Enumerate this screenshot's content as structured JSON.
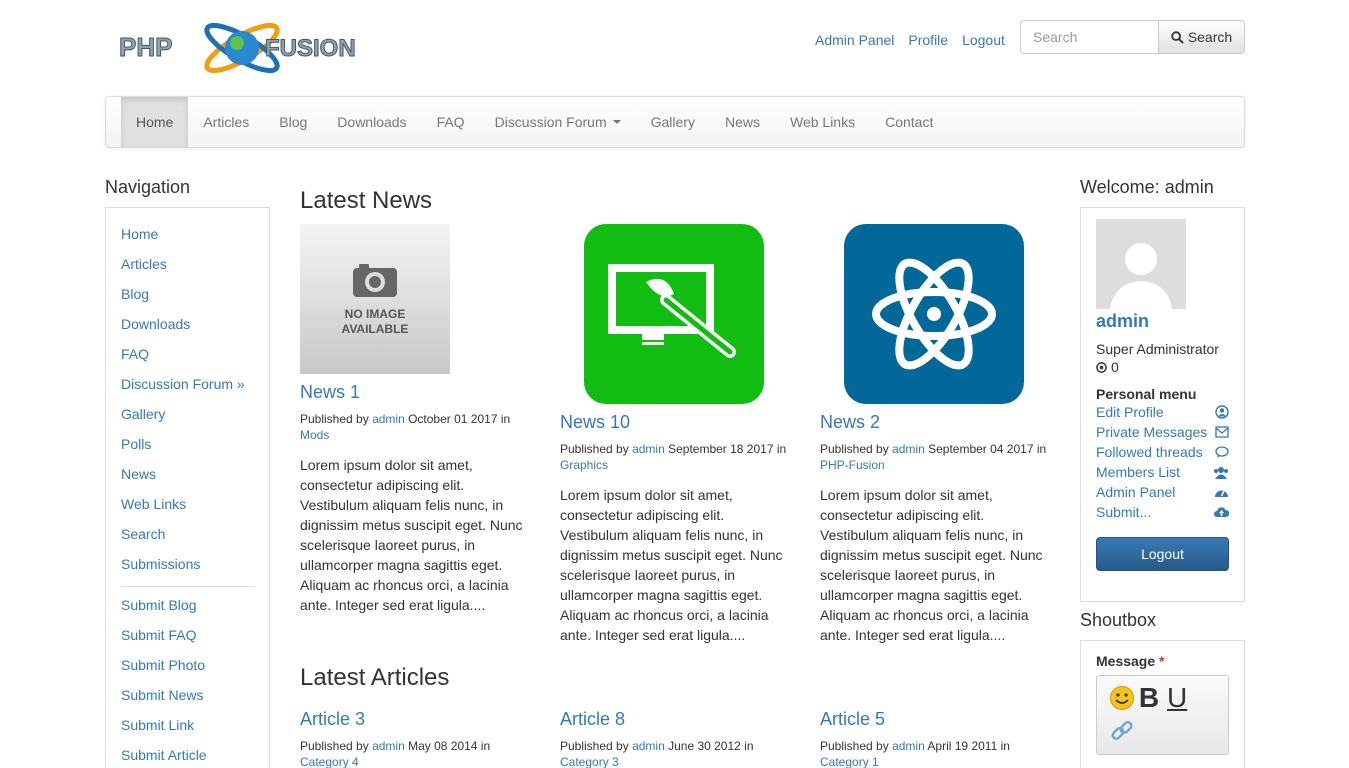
{
  "header": {
    "logo_text": "PHP-FUSION",
    "links": [
      "Admin Panel",
      "Profile",
      "Logout"
    ],
    "search_placeholder": "Search",
    "search_button": "Search"
  },
  "nav": {
    "items": [
      "Home",
      "Articles",
      "Blog",
      "Downloads",
      "FAQ",
      "Discussion Forum",
      "Gallery",
      "News",
      "Web Links",
      "Contact"
    ],
    "active": "Home"
  },
  "left_sidebar": {
    "title": "Navigation",
    "links": [
      "Home",
      "Articles",
      "Blog",
      "Downloads",
      "FAQ",
      "Discussion Forum »",
      "Gallery",
      "Polls",
      "News",
      "Web Links",
      "Search",
      "Submissions"
    ],
    "submit_links": [
      "Submit Blog",
      "Submit FAQ",
      "Submit Photo",
      "Submit News",
      "Submit Link",
      "Submit Article"
    ]
  },
  "latest_news": {
    "title": "Latest News",
    "no_image_text": "NO IMAGE AVAILABLE",
    "items": [
      {
        "title": "News 1",
        "published_by": "Published by",
        "author": "admin",
        "date": "October 01 2017 in",
        "category": "Mods",
        "excerpt": "Lorem ipsum dolor sit amet, consectetur adipiscing elit. Vestibulum aliquam felis nunc, in dignissim metus suscipit eget. Nunc scelerisque laoreet purus, in ullamcorper magna sagittis eget. Aliquam ac rhoncus orci, a lacinia ante. Integer sed erat ligula...."
      },
      {
        "title": "News 10",
        "published_by": "Published by",
        "author": "admin",
        "date": "September 18 2017 in",
        "category": "Graphics",
        "excerpt": "Lorem ipsum dolor sit amet, consectetur adipiscing elit. Vestibulum aliquam felis nunc, in dignissim metus suscipit eget. Nunc scelerisque laoreet purus, in ullamcorper magna sagittis eget. Aliquam ac rhoncus orci, a lacinia ante. Integer sed erat ligula...."
      },
      {
        "title": "News 2",
        "published_by": "Published by",
        "author": "admin",
        "date": "September 04 2017 in",
        "category": "PHP-Fusion",
        "excerpt": "Lorem ipsum dolor sit amet, consectetur adipiscing elit. Vestibulum aliquam felis nunc, in dignissim metus suscipit eget. Nunc scelerisque laoreet purus, in ullamcorper magna sagittis eget. Aliquam ac rhoncus orci, a lacinia ante. Integer sed erat ligula...."
      }
    ]
  },
  "latest_articles": {
    "title": "Latest Articles",
    "items": [
      {
        "title": "Article 3",
        "published_by": "Published by",
        "author": "admin",
        "date": "May 08 2014 in",
        "category": "Category 4"
      },
      {
        "title": "Article 8",
        "published_by": "Published by",
        "author": "admin",
        "date": "June 30 2012 in",
        "category": "Category 3"
      },
      {
        "title": "Article 5",
        "published_by": "Published by",
        "author": "admin",
        "date": "April 19 2011 in",
        "category": "Category 1"
      }
    ]
  },
  "user_panel": {
    "title": "Welcome: admin",
    "username": "admin",
    "role": "Super Administrator",
    "points": "0",
    "personal_menu_title": "Personal menu",
    "menu": [
      {
        "label": "Edit Profile",
        "icon": "user-circle-icon"
      },
      {
        "label": "Private Messages",
        "icon": "envelope-icon"
      },
      {
        "label": "Followed threads",
        "icon": "comment-icon"
      },
      {
        "label": "Members List",
        "icon": "users-icon"
      },
      {
        "label": "Admin Panel",
        "icon": "dashboard-icon"
      },
      {
        "label": "Submit...",
        "icon": "cloud-upload-icon"
      }
    ],
    "logout_label": "Logout"
  },
  "shoutbox": {
    "title": "Shoutbox",
    "message_label": "Message",
    "required_mark": "*"
  },
  "colors": {
    "link": "#337ab7",
    "green_thumb": "#11bd11",
    "blue_thumb": "#02689a",
    "logout_button": "#265a88"
  }
}
